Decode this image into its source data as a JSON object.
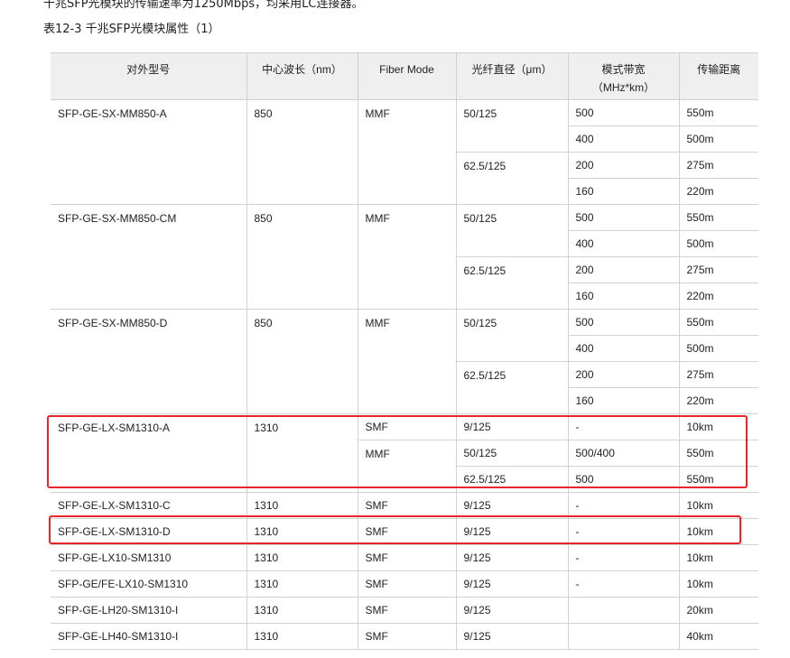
{
  "intro": "千兆SFP光模块的传输速率为1250Mbps，均采用LC连接器。",
  "caption": "表12-3 千兆SFP光模块属性（1）",
  "headers": [
    "对外型号",
    "中心波长（nm）",
    "Fiber Mode",
    "光纤直径（μm）",
    "模式带宽（MHz*km）",
    "传输距离"
  ],
  "groups": [
    {
      "model": "SFP-GE-SX-MM850-A",
      "wavelength": "850",
      "mode": "MMF",
      "rows": [
        {
          "diameter": "50/125",
          "bandwidth": "500",
          "distance": "550m"
        },
        {
          "diameter": "",
          "bandwidth": "400",
          "distance": "500m"
        },
        {
          "diameter": "62.5/125",
          "bandwidth": "200",
          "distance": "275m"
        },
        {
          "diameter": "",
          "bandwidth": "160",
          "distance": "220m"
        }
      ]
    },
    {
      "model": "SFP-GE-SX-MM850-CM",
      "wavelength": "850",
      "mode": "MMF",
      "rows": [
        {
          "diameter": "50/125",
          "bandwidth": "500",
          "distance": "550m"
        },
        {
          "diameter": "",
          "bandwidth": "400",
          "distance": "500m"
        },
        {
          "diameter": "62.5/125",
          "bandwidth": "200",
          "distance": "275m"
        },
        {
          "diameter": "",
          "bandwidth": "160",
          "distance": "220m"
        }
      ]
    },
    {
      "model": "SFP-GE-SX-MM850-D",
      "wavelength": "850",
      "mode": "MMF",
      "rows": [
        {
          "diameter": "50/125",
          "bandwidth": "500",
          "distance": "550m"
        },
        {
          "diameter": "",
          "bandwidth": "400",
          "distance": "500m"
        },
        {
          "diameter": "62.5/125",
          "bandwidth": "200",
          "distance": "275m"
        },
        {
          "diameter": "",
          "bandwidth": "160",
          "distance": "220m"
        }
      ]
    },
    {
      "model": "SFP-GE-LX-SM1310-A",
      "wavelength": "1310",
      "highlighted": true,
      "rows": [
        {
          "mode": "SMF",
          "diameter": "9/125",
          "bandwidth": "-",
          "distance": "10km"
        },
        {
          "mode": "MMF",
          "diameter": "50/125",
          "bandwidth": "500/400",
          "distance": "550m"
        },
        {
          "mode": "",
          "diameter": "62.5/125",
          "bandwidth": "500",
          "distance": "550m"
        }
      ]
    }
  ],
  "rows": [
    {
      "model": "SFP-GE-LX-SM1310-C",
      "wavelength": "1310",
      "mode": "SMF",
      "diameter": "9/125",
      "bandwidth": "-",
      "distance": "10km"
    },
    {
      "model": "SFP-GE-LX-SM1310-D",
      "wavelength": "1310",
      "mode": "SMF",
      "diameter": "9/125",
      "bandwidth": "-",
      "distance": "10km",
      "highlighted": true
    },
    {
      "model": "SFP-GE-LX10-SM1310",
      "wavelength": "1310",
      "mode": "SMF",
      "diameter": "9/125",
      "bandwidth": "-",
      "distance": "10km"
    },
    {
      "model": "SFP-GE/FE-LX10-SM1310",
      "wavelength": "1310",
      "mode": "SMF",
      "diameter": "9/125",
      "bandwidth": "-",
      "distance": "10km"
    },
    {
      "model": "SFP-GE-LH20-SM1310-I",
      "wavelength": "1310",
      "mode": "SMF",
      "diameter": "9/125",
      "bandwidth": "",
      "distance": "20km"
    },
    {
      "model": "SFP-GE-LH40-SM1310-I",
      "wavelength": "1310",
      "mode": "SMF",
      "diameter": "9/125",
      "bandwidth": "",
      "distance": "40km"
    }
  ],
  "highlight_color": "#e8262a",
  "header_bg": "#efefef"
}
